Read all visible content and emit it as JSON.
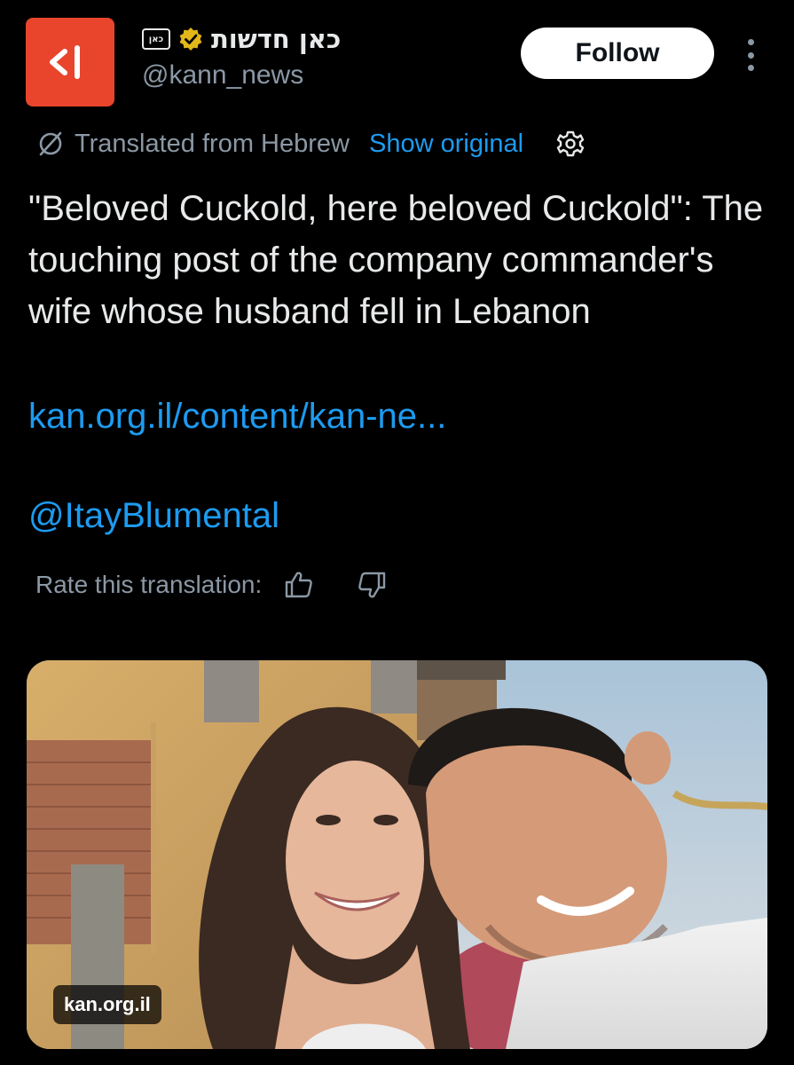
{
  "account": {
    "display_name": "כאן חדשות",
    "badge_text": "כאן",
    "handle": "@kann_news",
    "verified": true
  },
  "actions": {
    "follow_label": "Follow"
  },
  "translation": {
    "translated_from": "Translated from Hebrew",
    "show_original": "Show original",
    "rate_label": "Rate this translation:"
  },
  "tweet": {
    "text": "\"Beloved Cuckold, here beloved Cuckold\": The touching post of the company commander's wife whose husband fell in Lebanon",
    "link": "kan.org.il/content/kan-ne...",
    "mention": "@ItayBlumental"
  },
  "media": {
    "domain": "kan.org.il"
  },
  "colors": {
    "background": "#000000",
    "text": "#e7e9ea",
    "muted": "#8b98a5",
    "link": "#1d9bf0",
    "avatar_bg": "#e8452c",
    "verified_badge": "#e2b719"
  },
  "icons": [
    "kan-logo-icon",
    "kan-badge-icon",
    "verified-badge-icon",
    "more-icon",
    "translate-icon",
    "gear-icon",
    "thumbs-up-icon",
    "thumbs-down-icon"
  ]
}
